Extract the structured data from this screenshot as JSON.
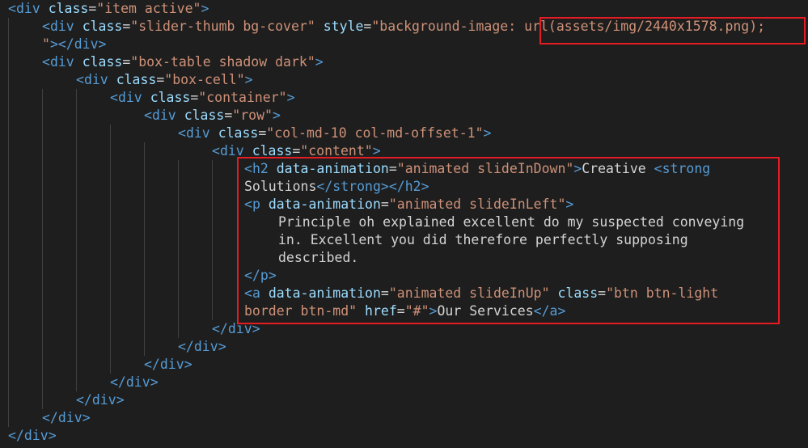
{
  "tokens": {
    "lt": "<",
    "lts": "</",
    "gt": ">",
    "eq": "=",
    "div": "div",
    "class": "class",
    "style": "style",
    "h2": "h2",
    "p": "p",
    "a": "a",
    "strong": "strong",
    "data_animation": "data-animation",
    "href": "href",
    "quote": "\"",
    "close_div": "></div>"
  },
  "strings": {
    "item_active": "\"item active\"",
    "slider_thumb": "\"slider-thumb bg-cover\"",
    "bg_image_prefix": "\"background-image",
    "bg_image_colon": ":",
    "bg_image_url": "url(assets/img/2440x1578.png);",
    "box_table": "\"box-table shadow dark\"",
    "box_cell": "\"box-cell\"",
    "container": "\"container\"",
    "row": "\"row\"",
    "col": "\"col-md-10 col-md-offset-1\"",
    "content": "\"content\"",
    "anim_slide_in_down": "\"animated slideInDown\"",
    "anim_slide_in_left": "\"animated slideInLeft\"",
    "anim_slide_in_up": "\"animated slideInUp\"",
    "btn_class_part1": "\"btn btn-light",
    "btn_class_part2": "border btn-md\"",
    "href_value": "\"#\""
  },
  "text": {
    "heading_creative": "Creative ",
    "heading_solutions": "Solutions",
    "paragraph_line1": "Principle oh explained excellent do my suspected conveying",
    "paragraph_line2": "in. Excellent you did therefore perfectly supposing",
    "paragraph_line3": "described.",
    "button_label": "Our Services"
  },
  "colors": {
    "background": "#1e1e1e",
    "tag": "#569cd6",
    "attribute": "#9cdcfe",
    "string": "#ce9178",
    "text": "#d4d4d4",
    "highlight_box": "#e51c23",
    "indent_guide": "#404040"
  }
}
